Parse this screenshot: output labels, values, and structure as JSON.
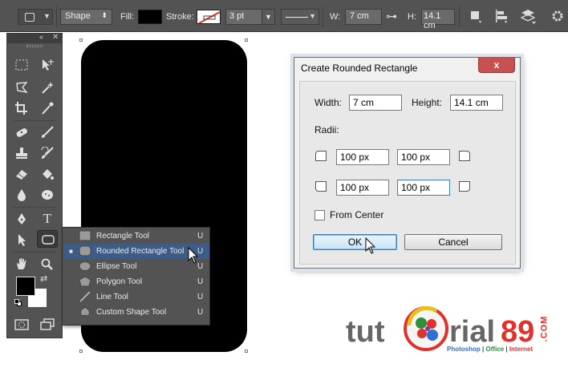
{
  "options_bar": {
    "mode": "Shape",
    "fill_label": "Fill:",
    "stroke_label": "Stroke:",
    "stroke_width": "3 pt",
    "width_label": "W:",
    "width_value": "7 cm",
    "height_label": "H:",
    "height_value": "14.1 cm",
    "fill_color": "#000000"
  },
  "flyout": {
    "items": [
      {
        "label": "Rectangle Tool",
        "key": "U",
        "icon": "rectangle-icon",
        "selected": false
      },
      {
        "label": "Rounded Rectangle Tool",
        "key": "U",
        "icon": "rounded-rectangle-icon",
        "selected": true
      },
      {
        "label": "Ellipse Tool",
        "key": "U",
        "icon": "ellipse-icon",
        "selected": false
      },
      {
        "label": "Polygon Tool",
        "key": "U",
        "icon": "polygon-icon",
        "selected": false
      },
      {
        "label": "Line Tool",
        "key": "U",
        "icon": "line-icon",
        "selected": false
      },
      {
        "label": "Custom Shape Tool",
        "key": "U",
        "icon": "custom-shape-icon",
        "selected": false
      }
    ],
    "highlight_color": "#3d5b85"
  },
  "dialog": {
    "title": "Create Rounded Rectangle",
    "close_label": "x",
    "width_label": "Width:",
    "width_value": "7 cm",
    "height_label": "Height:",
    "height_value": "14.1 cm",
    "radii_label": "Radii:",
    "radius_top_left": "100 px",
    "radius_top_right": "100 px",
    "radius_bottom_left": "100 px",
    "radius_bottom_right": "100 px",
    "from_center_label": "From Center",
    "from_center_checked": false,
    "ok_label": "OK",
    "cancel_label": "Cancel"
  },
  "watermark": {
    "part1": "tut",
    "part2": "rial",
    "part3": "89",
    "suffix": ".COM",
    "tagline_a": "Photoshop",
    "tagline_sep1": " | ",
    "tagline_b": "Office",
    "tagline_sep2": " | ",
    "tagline_c": "Internet"
  },
  "colors": {
    "ui_panel": "#535353",
    "accent_red": "#e0312c",
    "foreground": "#000000",
    "background": "#ffffff"
  }
}
